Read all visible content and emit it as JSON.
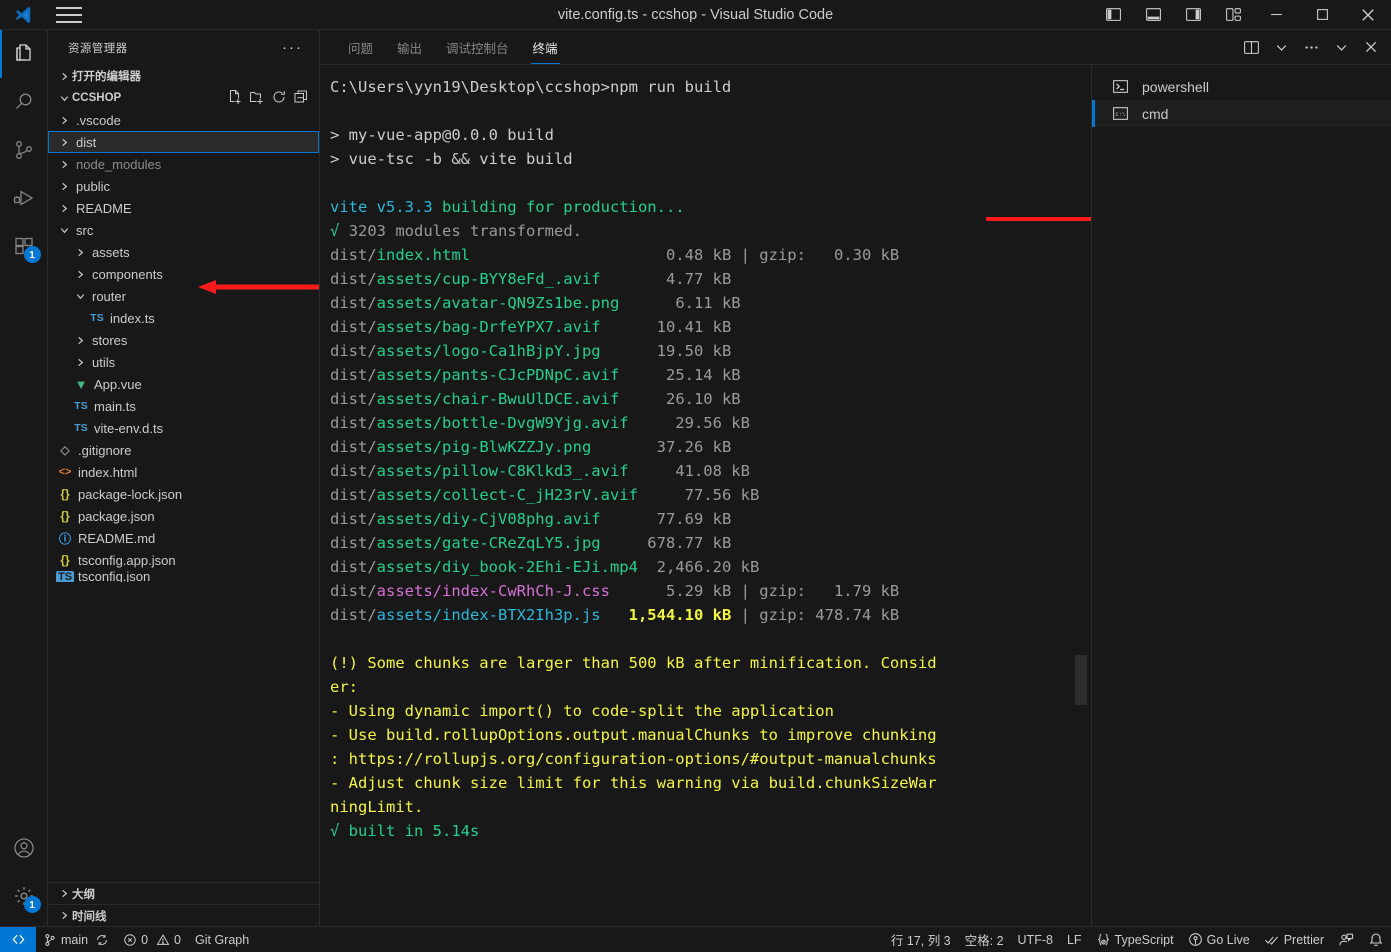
{
  "window": {
    "title": "vite.config.ts - ccshop - Visual Studio Code",
    "logo_icon": "vscode-logo-icon",
    "menu_icon": "hamburger-menu-icon",
    "layout_buttons": [
      {
        "icon": "toggle-primary-sidebar-icon",
        "label": "切换主侧栏"
      },
      {
        "icon": "toggle-panel-icon",
        "label": "切换面板"
      },
      {
        "icon": "toggle-secondary-sidebar-icon",
        "label": "切换次侧栏"
      },
      {
        "icon": "customize-layout-icon",
        "label": "自定义布局"
      }
    ],
    "controls": [
      {
        "icon": "minimize-icon",
        "label": "最小化"
      },
      {
        "icon": "maximize-icon",
        "label": "最大化"
      },
      {
        "icon": "close-icon",
        "label": "关闭"
      }
    ]
  },
  "activitybar": {
    "items": [
      {
        "icon": "explorer-icon",
        "label": "资源管理器",
        "active": true,
        "badge": ""
      },
      {
        "icon": "search-icon",
        "label": "搜索",
        "active": false,
        "badge": ""
      },
      {
        "icon": "source-control-icon",
        "label": "源代码管理",
        "active": false,
        "badge": ""
      },
      {
        "icon": "run-debug-icon",
        "label": "运行和调试",
        "active": false,
        "badge": ""
      },
      {
        "icon": "extensions-icon",
        "label": "扩展",
        "active": false,
        "badge": "1"
      }
    ],
    "bottom": [
      {
        "icon": "account-icon",
        "label": "账户",
        "badge": ""
      },
      {
        "icon": "gear-icon",
        "label": "管理",
        "badge": "1"
      }
    ]
  },
  "sidebar": {
    "title": "资源管理器",
    "more_actions": "···",
    "open_editors_label": "打开的编辑器",
    "folder_name": "CCSHOP",
    "folder_actions": [
      {
        "icon": "new-file-icon",
        "label": "新建文件"
      },
      {
        "icon": "new-folder-icon",
        "label": "新建文件夹"
      },
      {
        "icon": "refresh-icon",
        "label": "刷新资源管理器"
      },
      {
        "icon": "collapse-all-icon",
        "label": "在资源管理器中折叠文件夹"
      }
    ],
    "tree": [
      {
        "name": ".vscode",
        "type": "folder",
        "depth": 1,
        "expanded": false,
        "dim": false,
        "selected": false,
        "icon": ""
      },
      {
        "name": "dist",
        "type": "folder",
        "depth": 1,
        "expanded": false,
        "dim": false,
        "selected": true,
        "icon": ""
      },
      {
        "name": "node_modules",
        "type": "folder",
        "depth": 1,
        "expanded": false,
        "dim": true,
        "selected": false,
        "icon": ""
      },
      {
        "name": "public",
        "type": "folder",
        "depth": 1,
        "expanded": false,
        "dim": false,
        "selected": false,
        "icon": ""
      },
      {
        "name": "README",
        "type": "folder",
        "depth": 1,
        "expanded": false,
        "dim": false,
        "selected": false,
        "icon": ""
      },
      {
        "name": "src",
        "type": "folder",
        "depth": 1,
        "expanded": true,
        "dim": false,
        "selected": false,
        "icon": ""
      },
      {
        "name": "assets",
        "type": "folder",
        "depth": 2,
        "expanded": false,
        "dim": false,
        "selected": false,
        "icon": ""
      },
      {
        "name": "components",
        "type": "folder",
        "depth": 2,
        "expanded": false,
        "dim": false,
        "selected": false,
        "icon": ""
      },
      {
        "name": "router",
        "type": "folder",
        "depth": 2,
        "expanded": true,
        "dim": false,
        "selected": false,
        "icon": ""
      },
      {
        "name": "index.ts",
        "type": "file",
        "depth": 3,
        "expanded": false,
        "dim": false,
        "selected": false,
        "icon": "typescript-icon"
      },
      {
        "name": "stores",
        "type": "folder",
        "depth": 2,
        "expanded": false,
        "dim": false,
        "selected": false,
        "icon": ""
      },
      {
        "name": "utils",
        "type": "folder",
        "depth": 2,
        "expanded": false,
        "dim": false,
        "selected": false,
        "icon": ""
      },
      {
        "name": "App.vue",
        "type": "file",
        "depth": 2,
        "expanded": false,
        "dim": false,
        "selected": false,
        "icon": "vue-icon"
      },
      {
        "name": "main.ts",
        "type": "file",
        "depth": 2,
        "expanded": false,
        "dim": false,
        "selected": false,
        "icon": "typescript-icon"
      },
      {
        "name": "vite-env.d.ts",
        "type": "file",
        "depth": 2,
        "expanded": false,
        "dim": false,
        "selected": false,
        "icon": "typescript-icon"
      },
      {
        "name": ".gitignore",
        "type": "file",
        "depth": 1,
        "expanded": false,
        "dim": false,
        "selected": false,
        "icon": "git-icon"
      },
      {
        "name": "index.html",
        "type": "file",
        "depth": 1,
        "expanded": false,
        "dim": false,
        "selected": false,
        "icon": "html-icon"
      },
      {
        "name": "package-lock.json",
        "type": "file",
        "depth": 1,
        "expanded": false,
        "dim": false,
        "selected": false,
        "icon": "json-icon"
      },
      {
        "name": "package.json",
        "type": "file",
        "depth": 1,
        "expanded": false,
        "dim": false,
        "selected": false,
        "icon": "json-icon"
      },
      {
        "name": "README.md",
        "type": "file",
        "depth": 1,
        "expanded": false,
        "dim": false,
        "selected": false,
        "icon": "markdown-icon"
      },
      {
        "name": "tsconfig.app.json",
        "type": "file",
        "depth": 1,
        "expanded": false,
        "dim": false,
        "selected": false,
        "icon": "json-icon"
      },
      {
        "name": "tsconfig.json",
        "type": "file",
        "depth": 1,
        "expanded": false,
        "dim": false,
        "selected": false,
        "icon": "tsconfig-icon"
      }
    ],
    "outline_label": "大纲",
    "timeline_label": "时间线"
  },
  "panel": {
    "tabs": [
      {
        "label": "问题",
        "active": false
      },
      {
        "label": "输出",
        "active": false
      },
      {
        "label": "调试控制台",
        "active": false
      },
      {
        "label": "终端",
        "active": true
      }
    ],
    "actions": [
      {
        "icon": "split-terminal-icon",
        "label": "拆分终端"
      },
      {
        "icon": "chevron-down-icon",
        "label": "启动配置文件"
      },
      {
        "icon": "more-actions-icon",
        "label": "视图和更多操作"
      },
      {
        "icon": "chevron-down-icon",
        "label": "隐藏面板"
      },
      {
        "icon": "close-icon",
        "label": "关闭面板"
      }
    ],
    "terminal_list": [
      {
        "name": "powershell",
        "icon": "powershell-icon",
        "active": false
      },
      {
        "name": "cmd",
        "icon": "cmd-icon",
        "active": true
      }
    ]
  },
  "terminal": {
    "prompt": "C:\\Users\\yyn19\\Desktop\\ccshop>",
    "command": "npm run build",
    "pre_lines": [
      "",
      "> my-vue-app@0.0.0 build",
      "> vue-tsc -b && vite build",
      ""
    ],
    "vite_line": {
      "name": "vite v5.3.3",
      "rest": " building for production..."
    },
    "modules_line": "√ 3203 modules transformed.",
    "assets": [
      {
        "dir": "dist/",
        "file": "index.html",
        "size": "0.48 kB",
        "gzip": "0.30 kB",
        "color": "green",
        "bold_size": false
      },
      {
        "dir": "dist/",
        "file": "assets/cup-BYY8eFd_.avif",
        "size": "4.77 kB",
        "gzip": "",
        "color": "green",
        "bold_size": false
      },
      {
        "dir": "dist/",
        "file": "assets/avatar-QN9Zs1be.png",
        "size": "6.11 kB",
        "gzip": "",
        "color": "green",
        "bold_size": false
      },
      {
        "dir": "dist/",
        "file": "assets/bag-DrfeYPX7.avif",
        "size": "10.41 kB",
        "gzip": "",
        "color": "green",
        "bold_size": false
      },
      {
        "dir": "dist/",
        "file": "assets/logo-Ca1hBjpY.jpg",
        "size": "19.50 kB",
        "gzip": "",
        "color": "green",
        "bold_size": false
      },
      {
        "dir": "dist/",
        "file": "assets/pants-CJcPDNpC.avif",
        "size": "25.14 kB",
        "gzip": "",
        "color": "green",
        "bold_size": false
      },
      {
        "dir": "dist/",
        "file": "assets/chair-BwuUlDCE.avif",
        "size": "26.10 kB",
        "gzip": "",
        "color": "green",
        "bold_size": false
      },
      {
        "dir": "dist/",
        "file": "assets/bottle-DvgW9Yjg.avif",
        "size": "29.56 kB",
        "gzip": "",
        "color": "green",
        "bold_size": false
      },
      {
        "dir": "dist/",
        "file": "assets/pig-BlwKZZJy.png",
        "size": "37.26 kB",
        "gzip": "",
        "color": "green",
        "bold_size": false
      },
      {
        "dir": "dist/",
        "file": "assets/pillow-C8Klkd3_.avif",
        "size": "41.08 kB",
        "gzip": "",
        "color": "green",
        "bold_size": false
      },
      {
        "dir": "dist/",
        "file": "assets/collect-C_jH23rV.avif",
        "size": "77.56 kB",
        "gzip": "",
        "color": "green",
        "bold_size": false
      },
      {
        "dir": "dist/",
        "file": "assets/diy-CjV08phg.avif",
        "size": "77.69 kB",
        "gzip": "",
        "color": "green",
        "bold_size": false
      },
      {
        "dir": "dist/",
        "file": "assets/gate-CReZqLY5.jpg",
        "size": "678.77 kB",
        "gzip": "",
        "color": "green",
        "bold_size": false
      },
      {
        "dir": "dist/",
        "file": "assets/diy_book-2Ehi-EJi.mp4",
        "size": "2,466.20 kB",
        "gzip": "",
        "color": "green",
        "bold_size": false
      },
      {
        "dir": "dist/",
        "file": "assets/index-CwRhCh-J.css",
        "size": "5.29 kB",
        "gzip": "1.79 kB",
        "color": "magenta",
        "bold_size": false
      },
      {
        "dir": "dist/",
        "file": "assets/index-BTX2Ih3p.js",
        "size": "1,544.10 kB",
        "gzip": "478.74 kB",
        "color": "cyan",
        "bold_size": true
      }
    ],
    "gzip_label": "gzip:",
    "warning_lines": [
      "(!) Some chunks are larger than 500 kB after minification. Consid",
      "er:",
      "- Using dynamic import() to code-split the application",
      "- Use build.rollupOptions.output.manualChunks to improve chunking",
      ": https://rollupjs.org/configuration-options/#output-manualchunks",
      "- Adjust chunk size limit for this warning via build.chunkSizeWar",
      "ningLimit."
    ],
    "built_line": "√ built in 5.14s"
  },
  "statusbar": {
    "remote_icon": "remote-window-icon",
    "left": [
      {
        "icon": "source-control-branch-icon",
        "label": "main",
        "extra_icon": "sync-icon"
      },
      {
        "icon": "error-icon",
        "label": "0",
        "extra_icon": "warning-icon",
        "extra_label": "0"
      },
      {
        "icon": "",
        "label": "Git Graph",
        "extra_icon": ""
      }
    ],
    "branch": "main",
    "errors": "0",
    "warnings": "0",
    "git_graph": "Git Graph",
    "right": [
      {
        "icon": "",
        "label": "行 17, 列 3"
      },
      {
        "icon": "",
        "label": "空格: 2"
      },
      {
        "icon": "",
        "label": "UTF-8"
      },
      {
        "icon": "",
        "label": "LF"
      },
      {
        "icon": "typescript-status-icon",
        "label": "TypeScript"
      },
      {
        "icon": "broadcast-icon",
        "label": "Go Live"
      },
      {
        "icon": "check-all-icon",
        "label": "Prettier"
      },
      {
        "icon": "feedback-icon",
        "label": ""
      },
      {
        "icon": "bell-icon",
        "label": ""
      }
    ]
  },
  "annotations": {
    "arrow_color": "#fb1b1b",
    "underline_color": "#fb1b1b",
    "arrow_target": "dist",
    "underline_target": "npm run build"
  },
  "colors": {
    "accent": "#0078d4",
    "bg": "#181818",
    "fg": "#cccccc",
    "green": "#23d18b",
    "yellow": "#f5f543",
    "cyan": "#29b8db",
    "magenta": "#d670d6"
  }
}
